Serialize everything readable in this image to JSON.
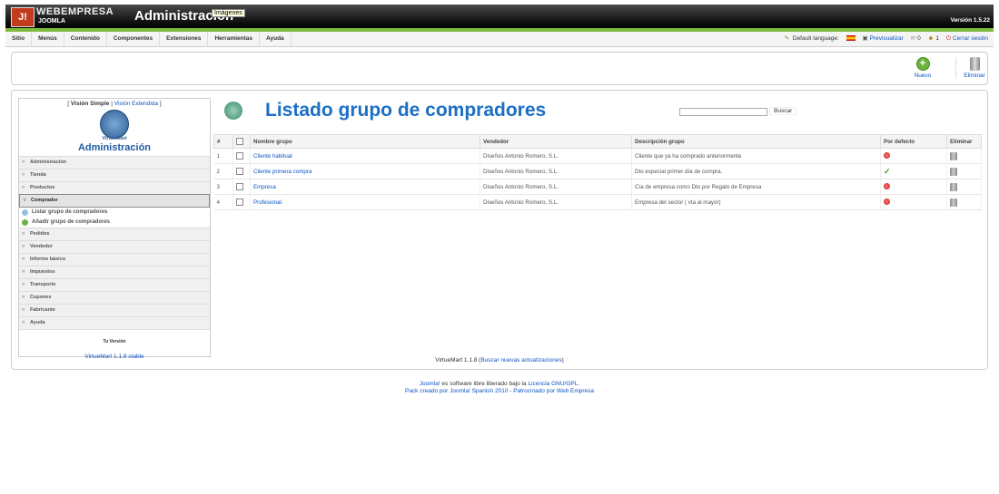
{
  "header": {
    "brand": "WEBEMPRESA",
    "brand_sub": "JOOMLA",
    "title": "Administración",
    "tooltip": "Imágenes",
    "version": "Versión 1.5.22"
  },
  "menu": {
    "items": [
      "Sitio",
      "Menús",
      "Contenido",
      "Componentes",
      "Extensiones",
      "Herramientas",
      "Ayuda"
    ],
    "default_language": "Default language:",
    "preview": "Previsualizar",
    "messages_count": "0",
    "users_count": "1",
    "logout": "Cerrar sesión"
  },
  "toolbar": {
    "new_label": "Nuevo",
    "delete_label": "Eliminar"
  },
  "sidebar": {
    "simple_view": "Visión Simple",
    "extended_view": "Visión Extendida",
    "logo_text": "VirtueMart",
    "title": "Administración",
    "items_top": [
      "Administración",
      "Tienda",
      "Productos"
    ],
    "active_item": "Comprador",
    "sub_items": [
      "Listar grupo de compradores",
      "Añadir grupo de compradores"
    ],
    "items_bottom": [
      "Pedidos",
      "Vendedor",
      "Informe básico",
      "Impuestos",
      "Transporte",
      "Cupones",
      "Fabricante",
      "Ayuda"
    ],
    "version_label": "Tu Versión",
    "version_link": "VirtueMart 1.1.8 stable"
  },
  "page": {
    "title": "Listado grupo de compradores",
    "search_button": "Buscar"
  },
  "table": {
    "headers": [
      "#",
      "",
      "Nombre grupo",
      "Vendedor",
      "Descripción grupo",
      "Por defecto",
      "Eliminar"
    ],
    "rows": [
      {
        "num": "1",
        "name": "Cliente habitual",
        "vendor": "Diseños Antonio Romero, S.L.",
        "desc": "Cliente que ya ha comprado anteriormente",
        "default": false
      },
      {
        "num": "2",
        "name": "Cliente primera compra",
        "vendor": "Diseños Antonio Romero, S.L.",
        "desc": "Dto especial primer día de compra.",
        "default": true
      },
      {
        "num": "3",
        "name": "Empresa",
        "vendor": "Diseños Antonio Romero, S.L.",
        "desc": "Cía de empresa como Dto por Regalo de Empresa",
        "default": false
      },
      {
        "num": "4",
        "name": "Profesional",
        "vendor": "Diseños Antonio Romero, S.L.",
        "desc": "Empresa del sector ( vta al mayor)",
        "default": false
      }
    ]
  },
  "vm_footer": {
    "prefix": "VirtueMart 1.1.8 (",
    "link": "Buscar nuevas actualizaciones",
    "suffix": ")"
  },
  "footer": {
    "line1_link1": "Joomla!",
    "line1_text": " es software libre liberado bajo la ",
    "line1_link2": "Licencia GNU/GPL",
    "line1_end": ".",
    "line2_link1": "Pack creado por Joomla! Spanish 2010",
    "line2_sep": " - ",
    "line2_link2": "Patrocinado por Web Empresa"
  },
  "colors": {
    "accent_green": "#7dbb3c",
    "title_blue": "#1d6fc4",
    "link_blue": "#0b55c4"
  }
}
